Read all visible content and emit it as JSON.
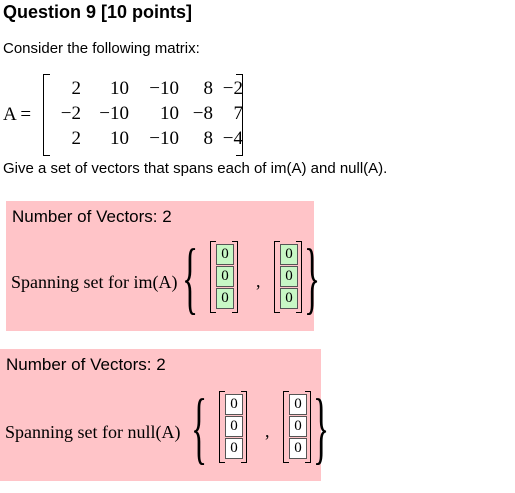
{
  "question": {
    "title": "Question 9 [10 points]"
  },
  "intro": "Consider the following matrix:",
  "matrix": {
    "label": "A =",
    "rows": [
      [
        "2",
        "10",
        "−10",
        "8",
        "−2"
      ],
      [
        "−2",
        "−10",
        "10",
        "−8",
        "7"
      ],
      [
        "2",
        "10",
        "−10",
        "8",
        "−4"
      ]
    ]
  },
  "prompt": "Give a set of vectors that spans each of im(A) and null(A).",
  "image_part": {
    "heading": "Number of Vectors: 2",
    "label": "Spanning set for im(A)",
    "entry_color": "#c8f7c5",
    "vectors": [
      [
        "0",
        "0",
        "0"
      ],
      [
        "0",
        "0",
        "0"
      ]
    ],
    "separator": ","
  },
  "null_part": {
    "heading": "Number of Vectors: 2",
    "label": "Spanning set for null(A)",
    "entry_color": "#ffffff",
    "vectors": [
      [
        "0",
        "0",
        "0"
      ],
      [
        "0",
        "0",
        "0"
      ]
    ],
    "separator": ","
  },
  "colors": {
    "panel_bg": "#ffc4c8"
  }
}
